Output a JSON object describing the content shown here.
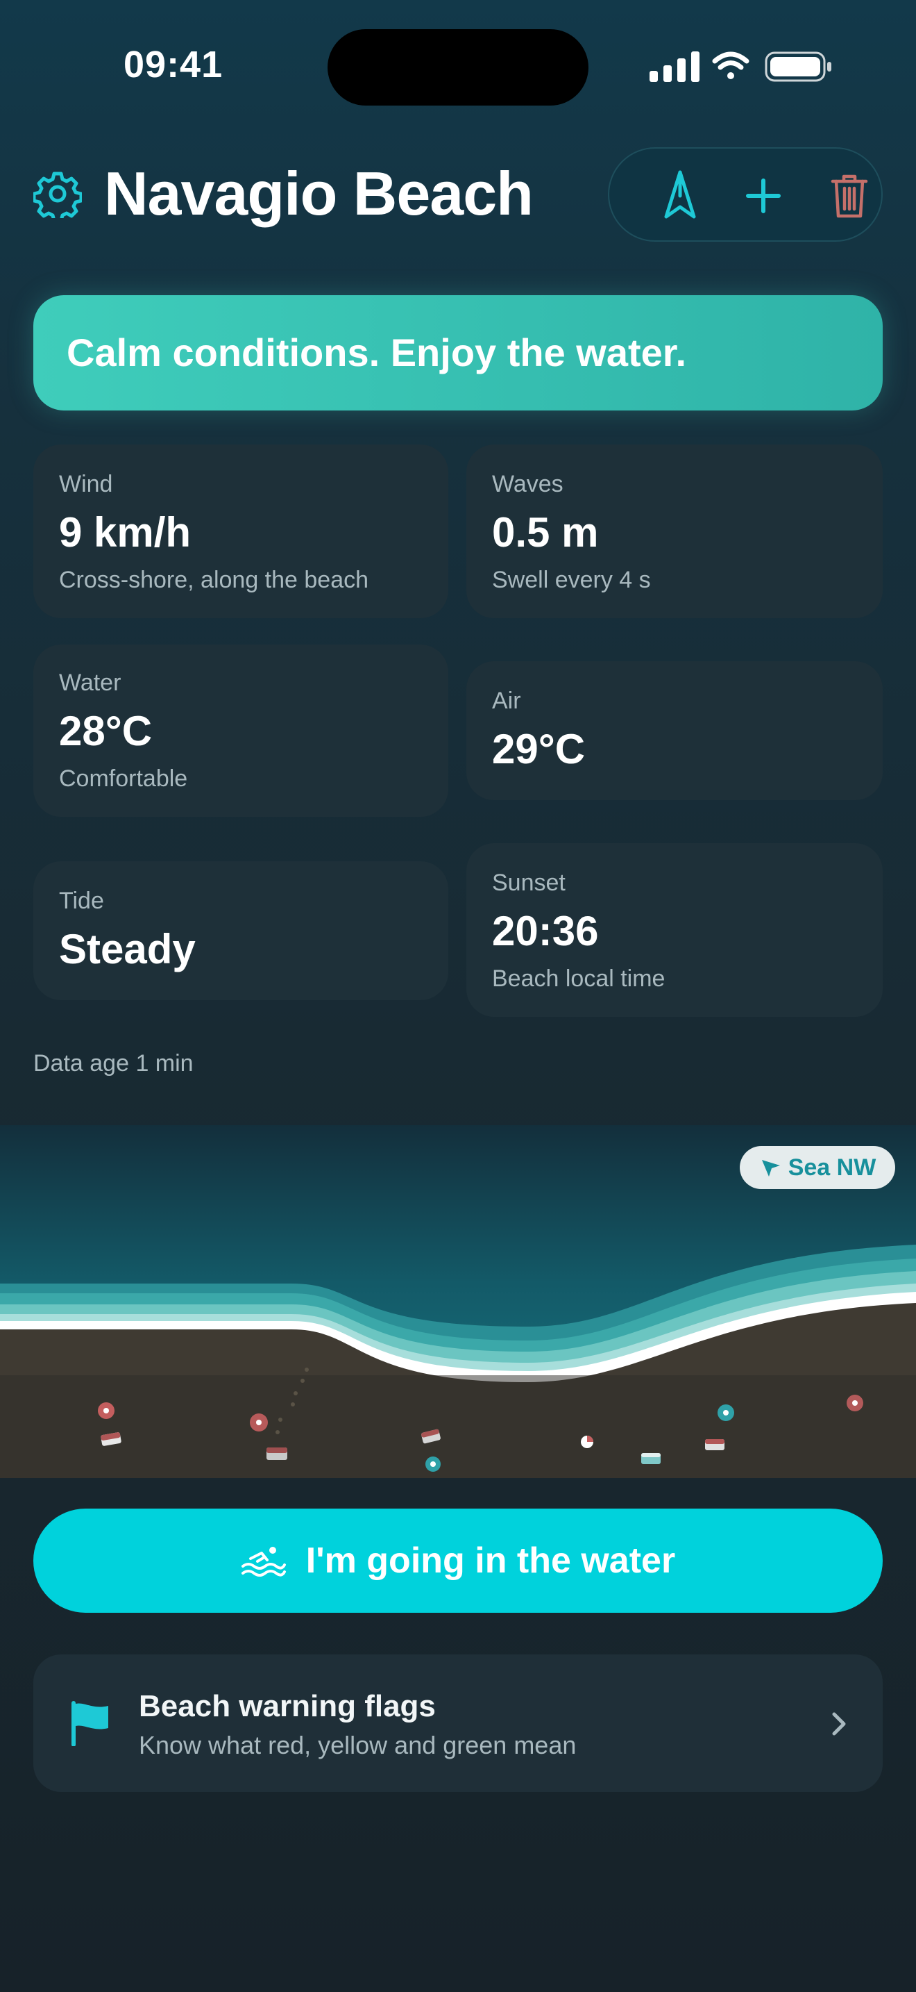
{
  "status": {
    "time": "09:41"
  },
  "header": {
    "title": "Navagio Beach"
  },
  "icons": {
    "gear": "gear-icon",
    "navigate": "navigation-arrow-icon",
    "add": "plus-icon",
    "delete": "trash-icon",
    "swimmer": "swimmer-icon",
    "flag": "flag-icon",
    "chevron": "chevron-right-icon",
    "location": "location-arrow-icon"
  },
  "banner": {
    "text": "Calm conditions. Enjoy the water."
  },
  "conditions": {
    "wind": {
      "label": "Wind",
      "value": "9 km/h",
      "sub": "Cross-shore, along the beach"
    },
    "waves": {
      "label": "Waves",
      "value": "0.5 m",
      "sub": "Swell every 4 s"
    },
    "water": {
      "label": "Water",
      "value": "28°C",
      "sub": "Comfortable"
    },
    "air": {
      "label": "Air",
      "value": "29°C"
    },
    "tide": {
      "label": "Tide",
      "value": "Steady"
    },
    "sunset": {
      "label": "Sunset",
      "value": "20:36",
      "sub": "Beach local time"
    }
  },
  "data_age": "Data age 1 min",
  "beach_view": {
    "badge": "Sea NW"
  },
  "cta": {
    "label": "I'm going in the water"
  },
  "flags_card": {
    "title": "Beach warning flags",
    "subtitle": "Know what red, yellow and green mean"
  },
  "colors": {
    "accent": "#00d2dc",
    "banner": "#3fcdbb",
    "card": "#1e3039"
  }
}
